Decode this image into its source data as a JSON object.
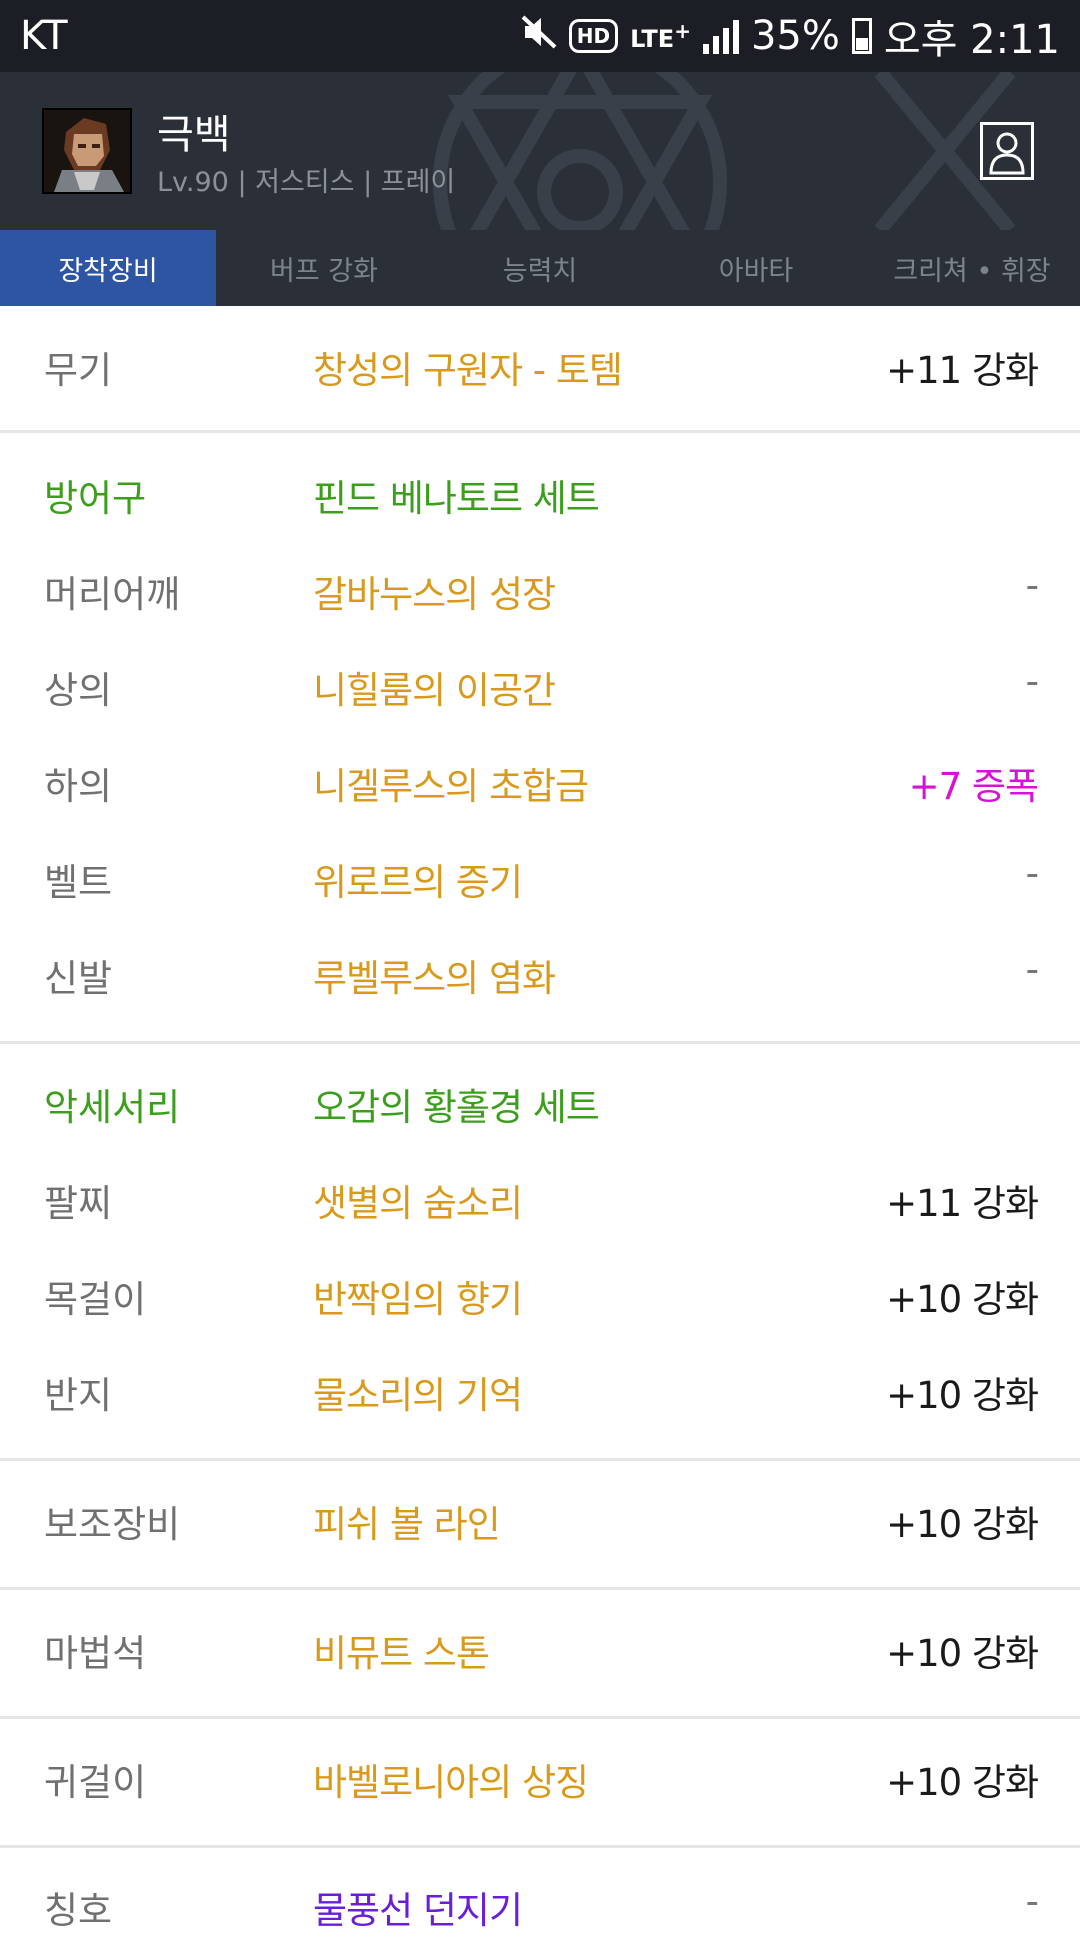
{
  "status_bar": {
    "carrier": "KT",
    "battery": "35%",
    "time": "오후 2:11",
    "icons": [
      "mute-icon",
      "hd-voice-icon",
      "lte-plus-icon",
      "signal-icon",
      "battery-icon"
    ]
  },
  "header": {
    "name": "극백",
    "subtitle": "Lv.90 | 저스티스 | 프레이"
  },
  "tabs": [
    {
      "label": "장착장비",
      "active": true
    },
    {
      "label": "버프 강화",
      "active": false
    },
    {
      "label": "능력치",
      "active": false
    },
    {
      "label": "아바타",
      "active": false
    },
    {
      "label": "크리쳐 • 휘장",
      "active": false
    }
  ],
  "equipment": {
    "weapon": {
      "label": "무기",
      "name": "창성의 구원자 - 토템",
      "value": "+11 강화"
    },
    "armor_set": {
      "label": "방어구",
      "name": "핀드 베나토르 세트"
    },
    "armor": [
      {
        "label": "머리어깨",
        "name": "갈바누스의 성장",
        "value": "-"
      },
      {
        "label": "상의",
        "name": "니힐룸의 이공간",
        "value": "-"
      },
      {
        "label": "하의",
        "name": "니겔루스의 초합금",
        "value": "+7 증폭"
      },
      {
        "label": "벨트",
        "name": "위로르의 증기",
        "value": "-"
      },
      {
        "label": "신발",
        "name": "루벨루스의 염화",
        "value": "-"
      }
    ],
    "accessory_set": {
      "label": "악세서리",
      "name": "오감의 황홀경 세트"
    },
    "accessories": [
      {
        "label": "팔찌",
        "name": "샛별의 숨소리",
        "value": "+11 강화"
      },
      {
        "label": "목걸이",
        "name": "반짝임의 향기",
        "value": "+10 강화"
      },
      {
        "label": "반지",
        "name": "물소리의 기억",
        "value": "+10 강화"
      }
    ],
    "sub_weapon": {
      "label": "보조장비",
      "name": "피쉬 볼 라인",
      "value": "+10 강화"
    },
    "magic_stone": {
      "label": "마법석",
      "name": "비뮤트 스톤",
      "value": "+10 강화"
    },
    "earring": {
      "label": "귀걸이",
      "name": "바벨로니아의 상징",
      "value": "+10 강화"
    },
    "title": {
      "label": "칭호",
      "name": "물풍선 던지기",
      "value": "-"
    }
  },
  "colors": {
    "header_bg": "#2b3038",
    "active_tab": "#2d55a3",
    "item_name": "#d99a1c",
    "set_green": "#3c9f1c",
    "amp_magenta": "#d612d6",
    "title_purple": "#6a1fd6"
  }
}
